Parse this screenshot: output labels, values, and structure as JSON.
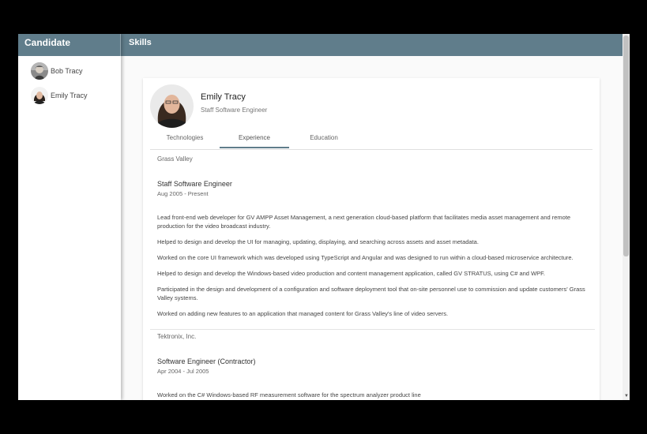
{
  "sidebar": {
    "header": "Candidate",
    "candidates": [
      {
        "name": "Bob Tracy"
      },
      {
        "name": "Emily Tracy"
      }
    ]
  },
  "main": {
    "header": "Skills"
  },
  "profile": {
    "name": "Emily Tracy",
    "title": "Staff Software Engineer"
  },
  "tabs": [
    {
      "label": "Technologies"
    },
    {
      "label": "Experience",
      "active": true
    },
    {
      "label": "Education"
    }
  ],
  "experience": [
    {
      "company": "Grass Valley",
      "role": "Staff Software Engineer",
      "dates": "Aug 2005 - Present",
      "bullets": [
        "Lead front-end web developer for GV AMPP Asset Management, a next generation cloud-based platform that facilitates media asset management and remote production for the video broadcast industry.",
        "Helped to design and develop the UI for managing, updating, displaying, and searching across assets and asset metadata.",
        "Worked on the core UI framework which was developed using TypeScript and Angular and was designed to run within a cloud-based microservice architecture.",
        "Helped to design and develop the Windows-based video production and content management application, called GV STRATUS, using C# and WPF.",
        "Participated in the design and development of a configuration and software deployment tool that on-site personnel use to commission and update customers' Grass Valley systems.",
        "Worked on adding new features to an application that managed content for Grass Valley's line of video servers."
      ]
    },
    {
      "company": "Tektronix, Inc.",
      "role": "Software Engineer (Contractor)",
      "dates": "Apr 2004 - Jul 2005",
      "bullets": [
        "Worked on the C# Windows-based RF measurement software for the spectrum analyzer product line"
      ]
    }
  ],
  "colors": {
    "header_bg": "#607d8b",
    "page_bg": "#fafafa"
  }
}
